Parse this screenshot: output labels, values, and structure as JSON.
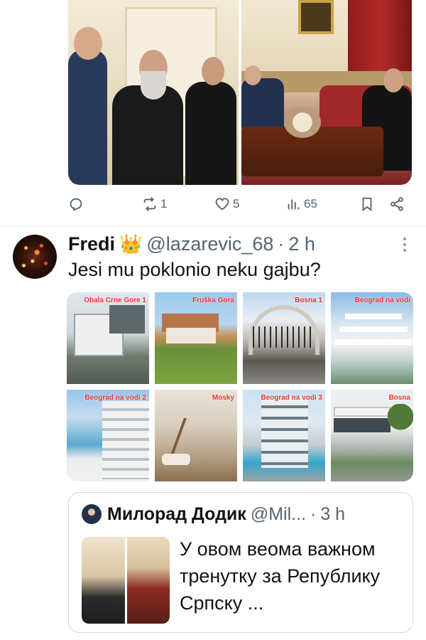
{
  "top_tweet": {
    "actions": {
      "reply_count": "",
      "retweet_count": "1",
      "like_count": "5",
      "views_count": "65"
    }
  },
  "reply_tweet": {
    "display_name": "Fredi",
    "crown_emoji": "👑",
    "handle": "@lazarevic_68",
    "separator": "·",
    "time": "2 h",
    "text": "Jesi mu poklonio neku gajbu?",
    "grid_labels": [
      "Obala Crne Gore 1",
      "Fruška Gora",
      "Bosna 1",
      "Beograd na vodi",
      "Beograd na vodi 2",
      "Mosky",
      "Beograd na vodi 3",
      "Bosna"
    ]
  },
  "quoted_tweet": {
    "display_name": "Милорад Додик",
    "handle": "@Mil...",
    "separator": "·",
    "time": "3 h",
    "text": "У овом веома важном тренутку за Републику Српску ..."
  },
  "colors": {
    "text_primary": "#0f1419",
    "text_secondary": "#536471",
    "border": "#cfd9de",
    "crown": "#f5b800",
    "label_red": "#e8312f"
  }
}
